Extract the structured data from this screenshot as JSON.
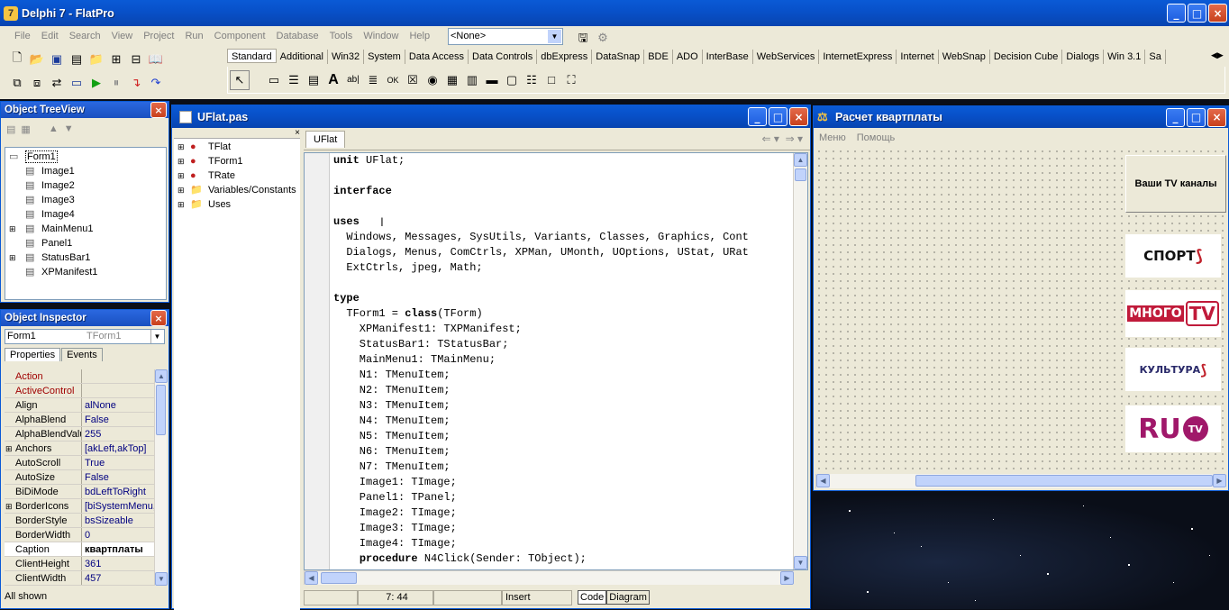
{
  "app": {
    "title": "Delphi 7 - FlatPro",
    "menu": [
      "File",
      "Edit",
      "Search",
      "View",
      "Project",
      "Run",
      "Component",
      "Database",
      "Tools",
      "Window",
      "Help"
    ],
    "config_combo": "<None>",
    "palette_tabs": [
      "Standard",
      "Additional",
      "Win32",
      "System",
      "Data Access",
      "Data Controls",
      "dbExpress",
      "DataSnap",
      "BDE",
      "ADO",
      "InterBase",
      "WebServices",
      "InternetExpress",
      "Internet",
      "WebSnap",
      "Decision Cube",
      "Dialogs",
      "Win 3.1",
      "Sa"
    ]
  },
  "treeview": {
    "title": "Object TreeView",
    "items": [
      {
        "label": "Form1",
        "level": 0
      },
      {
        "label": "Image1",
        "level": 1
      },
      {
        "label": "Image2",
        "level": 1
      },
      {
        "label": "Image3",
        "level": 1
      },
      {
        "label": "Image4",
        "level": 1
      },
      {
        "label": "MainMenu1",
        "level": 1,
        "expand": true
      },
      {
        "label": "Panel1",
        "level": 1
      },
      {
        "label": "StatusBar1",
        "level": 1,
        "expand": true
      },
      {
        "label": "XPManifest1",
        "level": 1
      }
    ]
  },
  "inspector": {
    "title": "Object Inspector",
    "object": "Form1",
    "object_type": "TForm1",
    "tabs": [
      "Properties",
      "Events"
    ],
    "status": "All shown",
    "rows": [
      {
        "name": "Action",
        "value": "",
        "red": true
      },
      {
        "name": "ActiveControl",
        "value": "",
        "red": true
      },
      {
        "name": "Align",
        "value": "alNone"
      },
      {
        "name": "AlphaBlend",
        "value": "False"
      },
      {
        "name": "AlphaBlendValu",
        "value": "255"
      },
      {
        "name": "Anchors",
        "value": "[akLeft,akTop]",
        "plus": true
      },
      {
        "name": "AutoScroll",
        "value": "True"
      },
      {
        "name": "AutoSize",
        "value": "False"
      },
      {
        "name": "BiDiMode",
        "value": "bdLeftToRight"
      },
      {
        "name": "BorderIcons",
        "value": "[biSystemMenu,",
        "plus": true
      },
      {
        "name": "BorderStyle",
        "value": "bsSizeable"
      },
      {
        "name": "BorderWidth",
        "value": "0"
      },
      {
        "name": "Caption",
        "value": "квартплаты",
        "selected": true
      },
      {
        "name": "ClientHeight",
        "value": "361"
      },
      {
        "name": "ClientWidth",
        "value": "457"
      }
    ]
  },
  "editor": {
    "title": "UFlat.pas",
    "tab": "UFlat",
    "explorer": [
      "TFlat",
      "TForm1",
      "TRate",
      "Variables/Constants",
      "Uses"
    ],
    "lines": [
      [
        {
          "t": "unit",
          "b": true
        },
        {
          "t": " UFlat;"
        }
      ],
      [],
      [
        {
          "t": "interface",
          "b": true
        }
      ],
      [],
      [
        {
          "t": "uses",
          "b": true
        }
      ],
      [
        {
          "t": "  Windows, Messages, SysUtils, Variants, Classes, Graphics, Cont"
        }
      ],
      [
        {
          "t": "  Dialogs, Menus, ComCtrls, XPMan, UMonth, UOptions, UStat, URat"
        }
      ],
      [
        {
          "t": "  ExtCtrls, jpeg, Math;"
        }
      ],
      [],
      [
        {
          "t": "type",
          "b": true
        }
      ],
      [
        {
          "t": "  TForm1 = "
        },
        {
          "t": "class",
          "b": true
        },
        {
          "t": "(TForm)"
        }
      ],
      [
        {
          "t": "    XPManifest1: TXPManifest;"
        }
      ],
      [
        {
          "t": "    StatusBar1: TStatusBar;"
        }
      ],
      [
        {
          "t": "    MainMenu1: TMainMenu;"
        }
      ],
      [
        {
          "t": "    N1: TMenuItem;"
        }
      ],
      [
        {
          "t": "    N2: TMenuItem;"
        }
      ],
      [
        {
          "t": "    N3: TMenuItem;"
        }
      ],
      [
        {
          "t": "    N4: TMenuItem;"
        }
      ],
      [
        {
          "t": "    N5: TMenuItem;"
        }
      ],
      [
        {
          "t": "    N6: TMenuItem;"
        }
      ],
      [
        {
          "t": "    N7: TMenuItem;"
        }
      ],
      [
        {
          "t": "    Image1: TImage;"
        }
      ],
      [
        {
          "t": "    Panel1: TPanel;"
        }
      ],
      [
        {
          "t": "    Image2: TImage;"
        }
      ],
      [
        {
          "t": "    Image3: TImage;"
        }
      ],
      [
        {
          "t": "    Image4: TImage;"
        }
      ],
      [
        {
          "t": "    "
        },
        {
          "t": "procedure",
          "b": true
        },
        {
          "t": " N4Click(Sender: TObject);"
        }
      ]
    ],
    "status": {
      "pos": "7: 44",
      "mode": "Insert",
      "tab_code": "Code",
      "tab_diagram": "Diagram"
    }
  },
  "form": {
    "title": "Расчет квартплаты",
    "menu": [
      "Меню",
      "Помощь"
    ],
    "button": "Ваши TV  каналы",
    "logos": [
      "СПОРТ",
      "МНОГО",
      "TV",
      "КУЛЬТУРА",
      "RU",
      "TV"
    ]
  }
}
